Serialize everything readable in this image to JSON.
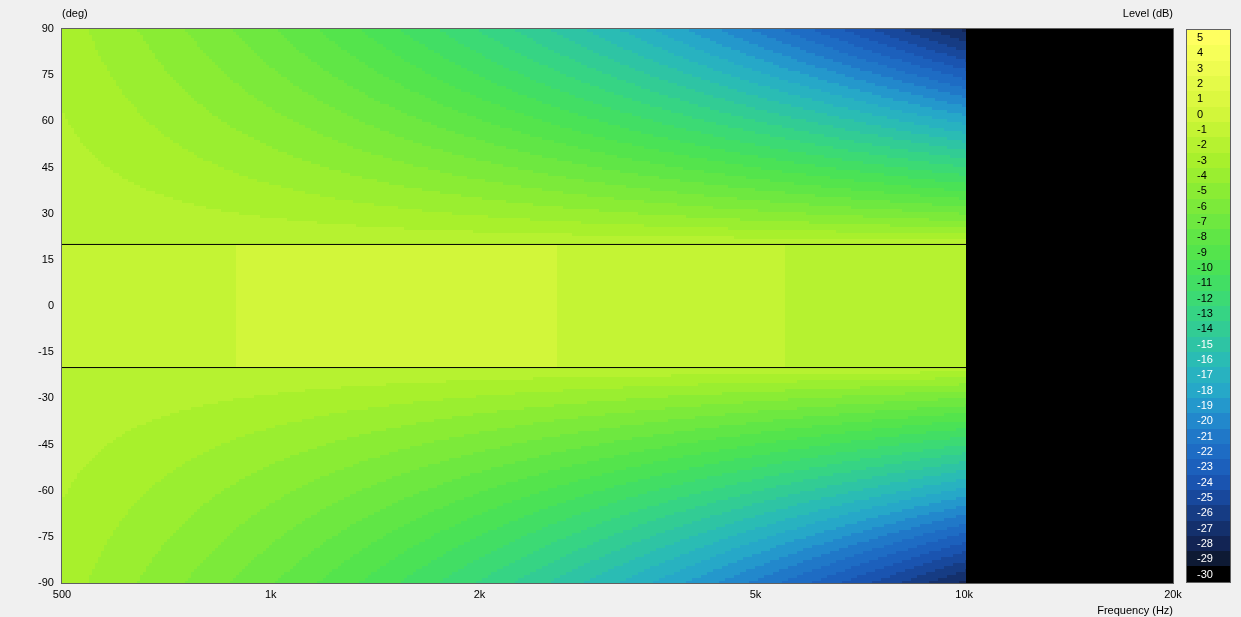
{
  "y_axis": {
    "label": "(deg)",
    "ticks": [
      "90",
      "75",
      "60",
      "45",
      "30",
      "15",
      "0",
      "-15",
      "-30",
      "-45",
      "-60",
      "-75",
      "-90"
    ]
  },
  "x_axis": {
    "label": "Frequency  (Hz)",
    "ticks": [
      "500",
      "1k",
      "2k",
      "5k",
      "10k",
      "20k"
    ]
  },
  "colorbar": {
    "title": "Level  (dB)",
    "levels": [
      {
        "label": "5",
        "color": "#ffff60"
      },
      {
        "label": "4",
        "color": "#f6ff58"
      },
      {
        "label": "3",
        "color": "#eefc50"
      },
      {
        "label": "2",
        "color": "#e4fa48"
      },
      {
        "label": "1",
        "color": "#dcf840"
      },
      {
        "label": "0",
        "color": "#d2f63a"
      },
      {
        "label": "-1",
        "color": "#c4f434"
      },
      {
        "label": "-2",
        "color": "#b6f230"
      },
      {
        "label": "-3",
        "color": "#a8f02c"
      },
      {
        "label": "-4",
        "color": "#9aee30"
      },
      {
        "label": "-5",
        "color": "#8aec34"
      },
      {
        "label": "-6",
        "color": "#7cea3a"
      },
      {
        "label": "-7",
        "color": "#6ee840"
      },
      {
        "label": "-8",
        "color": "#60e646"
      },
      {
        "label": "-9",
        "color": "#54e44c"
      },
      {
        "label": "-10",
        "color": "#4ae256"
      },
      {
        "label": "-11",
        "color": "#42de64"
      },
      {
        "label": "-12",
        "color": "#3cda74"
      },
      {
        "label": "-13",
        "color": "#36d484"
      },
      {
        "label": "-14",
        "color": "#32cc94"
      },
      {
        "label": "-15",
        "color": "#2ec4a4"
      },
      {
        "label": "-16",
        "color": "#2abcb4"
      },
      {
        "label": "-17",
        "color": "#28b2c0"
      },
      {
        "label": "-18",
        "color": "#26a8c8"
      },
      {
        "label": "-19",
        "color": "#2498cc"
      },
      {
        "label": "-20",
        "color": "#2288cc"
      },
      {
        "label": "-21",
        "color": "#2078c8"
      },
      {
        "label": "-22",
        "color": "#1e6cc4"
      },
      {
        "label": "-23",
        "color": "#1c60bc"
      },
      {
        "label": "-24",
        "color": "#1a54b0"
      },
      {
        "label": "-25",
        "color": "#18489c"
      },
      {
        "label": "-26",
        "color": "#163c84"
      },
      {
        "label": "-27",
        "color": "#14306c"
      },
      {
        "label": "-28",
        "color": "#122454"
      },
      {
        "label": "-29",
        "color": "#0e1a34"
      },
      {
        "label": "-30",
        "color": "#000000"
      }
    ]
  }
}
